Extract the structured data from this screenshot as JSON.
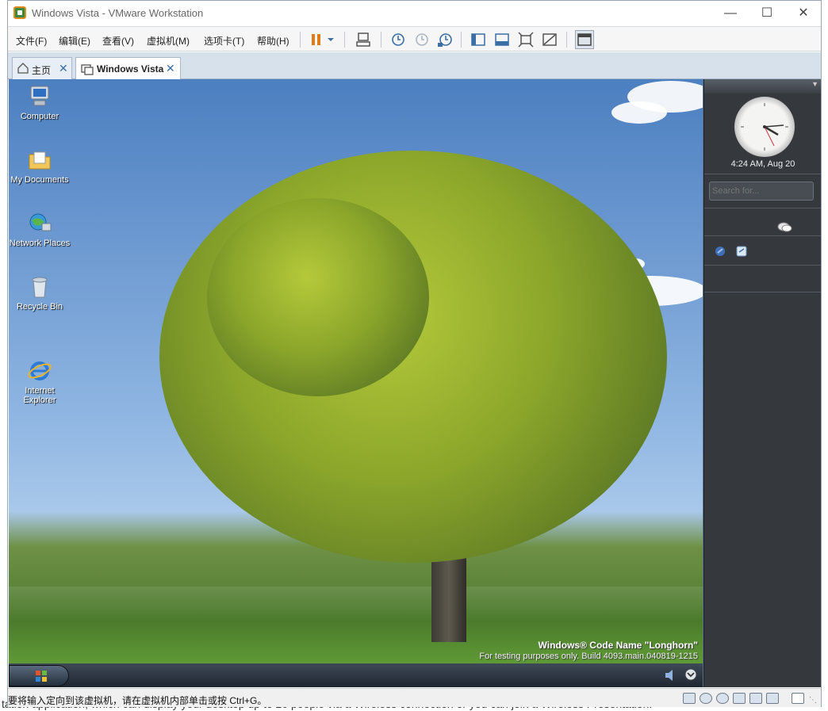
{
  "window": {
    "title": "Windows Vista - VMware Workstation"
  },
  "menu": {
    "items": [
      "文件(F)",
      "编辑(E)",
      "查看(V)",
      "虚拟机(M)",
      "选项卡(T)",
      "帮助(H)"
    ]
  },
  "tabs": [
    {
      "label": "主页",
      "close": "✕"
    },
    {
      "label": "Windows Vista",
      "close": "✕"
    }
  ],
  "desktop": {
    "icons": [
      {
        "label": "Computer"
      },
      {
        "label": "My Documents"
      },
      {
        "label": "Network Places"
      },
      {
        "label": "Recycle Bin"
      },
      {
        "label": "Internet\nExplorer"
      }
    ],
    "watermark_line1": "Windows® Code Name \"Longhorn\"",
    "watermark_line2": "For testing purposes only. Build 4093.main.040819-1215"
  },
  "sidebar": {
    "time": "4:24 AM, Aug 20",
    "search_placeholder": "Search for..."
  },
  "status": {
    "text": "要将输入定向到该虚拟机，请在虚拟机内部单击或按 Ctrl+G。"
  },
  "background_page": {
    "bottom_text": "tation application, which can display your desktop up to 20 people via a Wireless connection or you can join a Wireless Presentation."
  },
  "colors": {
    "accent": "#3a6ea5",
    "pause": "#e07b1a",
    "sidebar": "#35393e"
  }
}
